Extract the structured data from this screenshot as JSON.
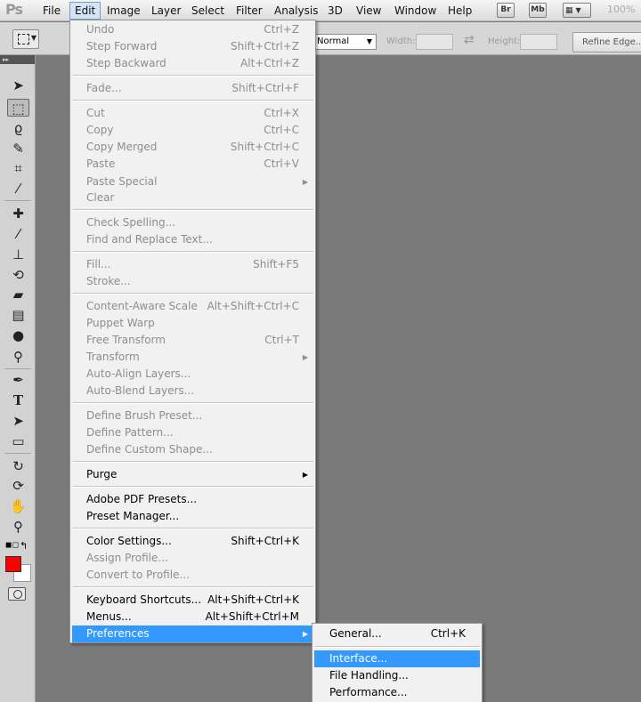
{
  "app": {
    "logo": "Ps",
    "zoom": "100%"
  },
  "menubar": {
    "items": [
      "File",
      "Edit",
      "Image",
      "Layer",
      "Select",
      "Filter",
      "Analysis",
      "3D",
      "View",
      "Window",
      "Help"
    ],
    "bridge_label": "Br",
    "minibridge_label": "Mb"
  },
  "options_bar": {
    "style_value": "Normal",
    "width_label": "Width:",
    "height_label": "Height:",
    "refine_edge_label": "Refine Edge..."
  },
  "tools": {
    "icons": [
      "move-tool-icon",
      "rectangular-marquee-tool-icon",
      "lasso-tool-icon",
      "quick-selection-tool-icon",
      "crop-tool-icon",
      "eyedropper-tool-icon",
      "spot-healing-brush-tool-icon",
      "brush-tool-icon",
      "clone-stamp-tool-icon",
      "history-brush-tool-icon",
      "eraser-tool-icon",
      "gradient-tool-icon",
      "blur-tool-icon",
      "dodge-tool-icon",
      "pen-tool-icon",
      "type-tool-icon",
      "path-selection-tool-icon",
      "rectangle-tool-icon",
      "3d-rotate-tool-icon",
      "3d-orbit-tool-icon",
      "hand-tool-icon",
      "zoom-tool-icon"
    ],
    "type_glyph": "T",
    "foreground_color": "#ff0000",
    "background_color": "#ffffff"
  },
  "edit_menu": {
    "undo": {
      "label": "Undo",
      "shortcut": "Ctrl+Z"
    },
    "step_forward": {
      "label": "Step Forward",
      "shortcut": "Shift+Ctrl+Z"
    },
    "step_backward": {
      "label": "Step Backward",
      "shortcut": "Alt+Ctrl+Z"
    },
    "fade": {
      "label": "Fade...",
      "shortcut": "Shift+Ctrl+F"
    },
    "cut": {
      "label": "Cut",
      "shortcut": "Ctrl+X"
    },
    "copy": {
      "label": "Copy",
      "shortcut": "Ctrl+C"
    },
    "copy_merged": {
      "label": "Copy Merged",
      "shortcut": "Shift+Ctrl+C"
    },
    "paste": {
      "label": "Paste",
      "shortcut": "Ctrl+V"
    },
    "paste_special": {
      "label": "Paste Special"
    },
    "clear": {
      "label": "Clear"
    },
    "check_spelling": {
      "label": "Check Spelling..."
    },
    "find_replace": {
      "label": "Find and Replace Text..."
    },
    "fill": {
      "label": "Fill...",
      "shortcut": "Shift+F5"
    },
    "stroke": {
      "label": "Stroke..."
    },
    "content_aware_scale": {
      "label": "Content-Aware Scale",
      "shortcut": "Alt+Shift+Ctrl+C"
    },
    "puppet_warp": {
      "label": "Puppet Warp"
    },
    "free_transform": {
      "label": "Free Transform",
      "shortcut": "Ctrl+T"
    },
    "transform": {
      "label": "Transform"
    },
    "auto_align": {
      "label": "Auto-Align Layers..."
    },
    "auto_blend": {
      "label": "Auto-Blend Layers..."
    },
    "define_brush": {
      "label": "Define Brush Preset..."
    },
    "define_pattern": {
      "label": "Define Pattern..."
    },
    "define_shape": {
      "label": "Define Custom Shape..."
    },
    "purge": {
      "label": "Purge"
    },
    "pdf_presets": {
      "label": "Adobe PDF Presets..."
    },
    "preset_manager": {
      "label": "Preset Manager..."
    },
    "color_settings": {
      "label": "Color Settings...",
      "shortcut": "Shift+Ctrl+K"
    },
    "assign_profile": {
      "label": "Assign Profile..."
    },
    "convert_profile": {
      "label": "Convert to Profile..."
    },
    "keyboard_shortcuts": {
      "label": "Keyboard Shortcuts...",
      "shortcut": "Alt+Shift+Ctrl+K"
    },
    "menus": {
      "label": "Menus...",
      "shortcut": "Alt+Shift+Ctrl+M"
    },
    "preferences": {
      "label": "Preferences"
    }
  },
  "preferences_submenu": {
    "general": {
      "label": "General...",
      "shortcut": "Ctrl+K"
    },
    "interface": {
      "label": "Interface..."
    },
    "file_handling": {
      "label": "File Handling..."
    },
    "performance": {
      "label": "Performance..."
    }
  },
  "colors": {
    "highlight": "#3399ff",
    "disabled_text": "#8d8d8d",
    "canvas_bg": "#7a7a7a"
  }
}
